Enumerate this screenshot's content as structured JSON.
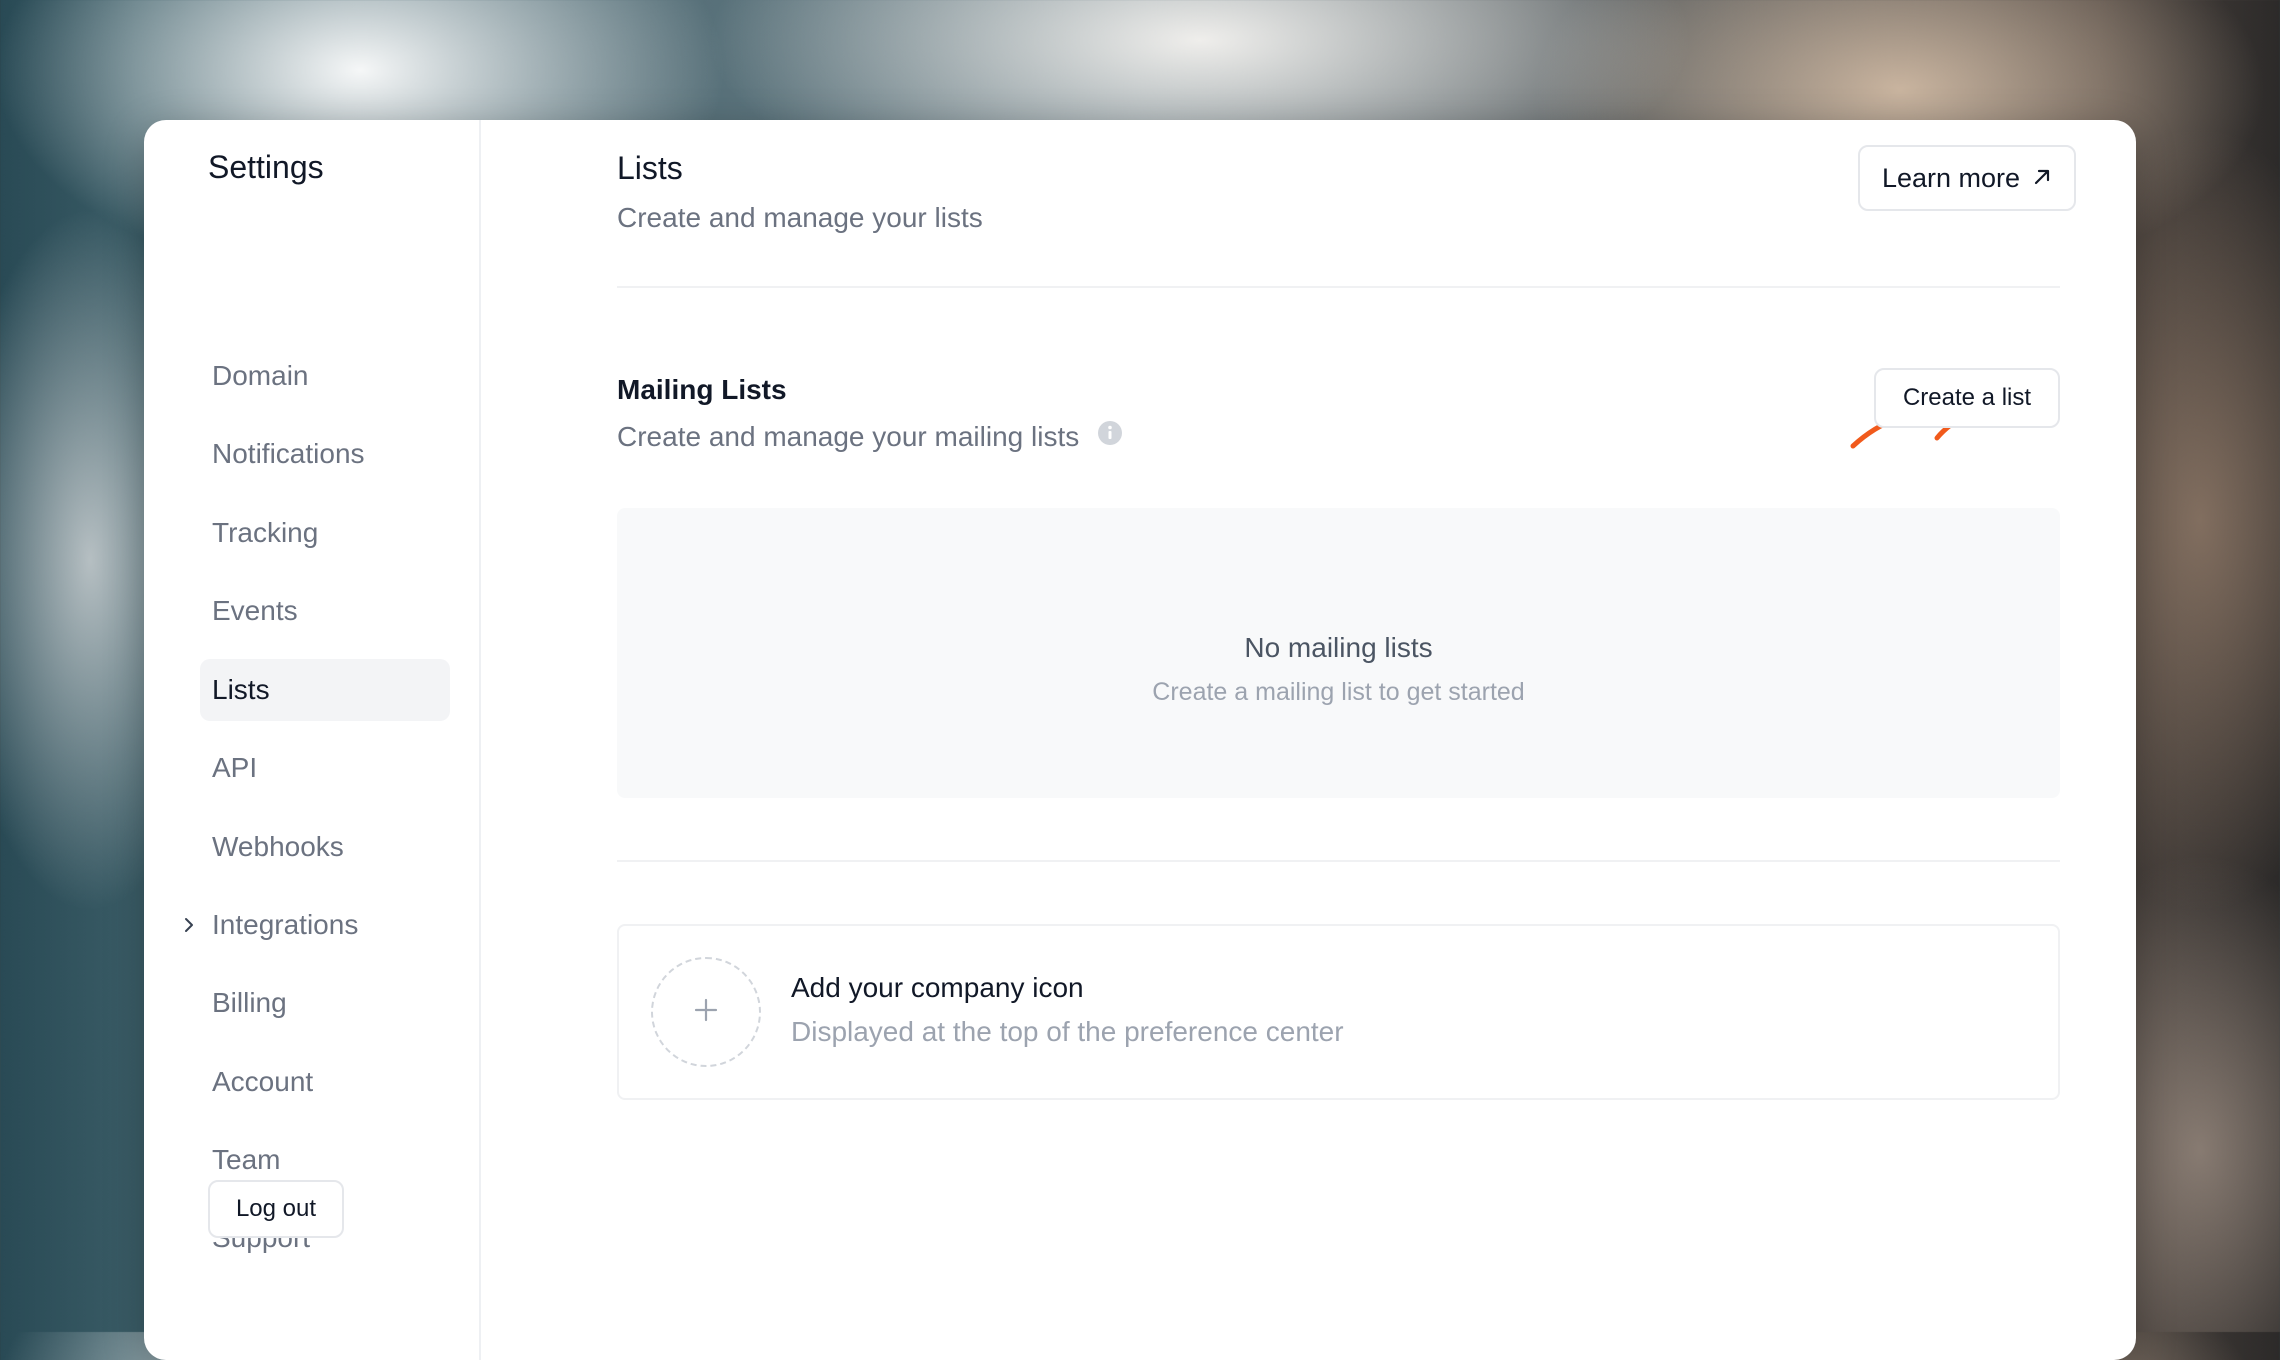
{
  "sidebar": {
    "title": "Settings",
    "items": [
      {
        "label": "Domain"
      },
      {
        "label": "Notifications"
      },
      {
        "label": "Tracking"
      },
      {
        "label": "Events"
      },
      {
        "label": "Lists",
        "active": true
      },
      {
        "label": "API"
      },
      {
        "label": "Webhooks"
      },
      {
        "label": "Integrations",
        "expandable": true
      },
      {
        "label": "Billing"
      },
      {
        "label": "Account"
      },
      {
        "label": "Team"
      },
      {
        "label": "Support"
      }
    ],
    "logout_label": "Log out"
  },
  "header": {
    "title": "Lists",
    "subtitle": "Create and manage your lists",
    "learn_more_label": "Learn more",
    "learn_more_icon": "external-arrow-icon"
  },
  "mailing_lists": {
    "title": "Mailing Lists",
    "subtitle": "Create and manage your mailing lists",
    "info_icon": "info-icon",
    "create_label": "Create a list",
    "annotation_icon": "hand-drawn-arrow-icon",
    "empty_title": "No mailing lists",
    "empty_subtitle": "Create a mailing list to get started"
  },
  "company_icon": {
    "title": "Add your company icon",
    "subtitle": "Displayed at the top of the preference center",
    "add_icon": "plus-icon"
  },
  "colors": {
    "accent": "#f15a1c",
    "text_primary": "#111827",
    "text_secondary": "#6b7280",
    "active_bg": "#f3f4f6",
    "empty_bg": "#f8f9fa"
  }
}
